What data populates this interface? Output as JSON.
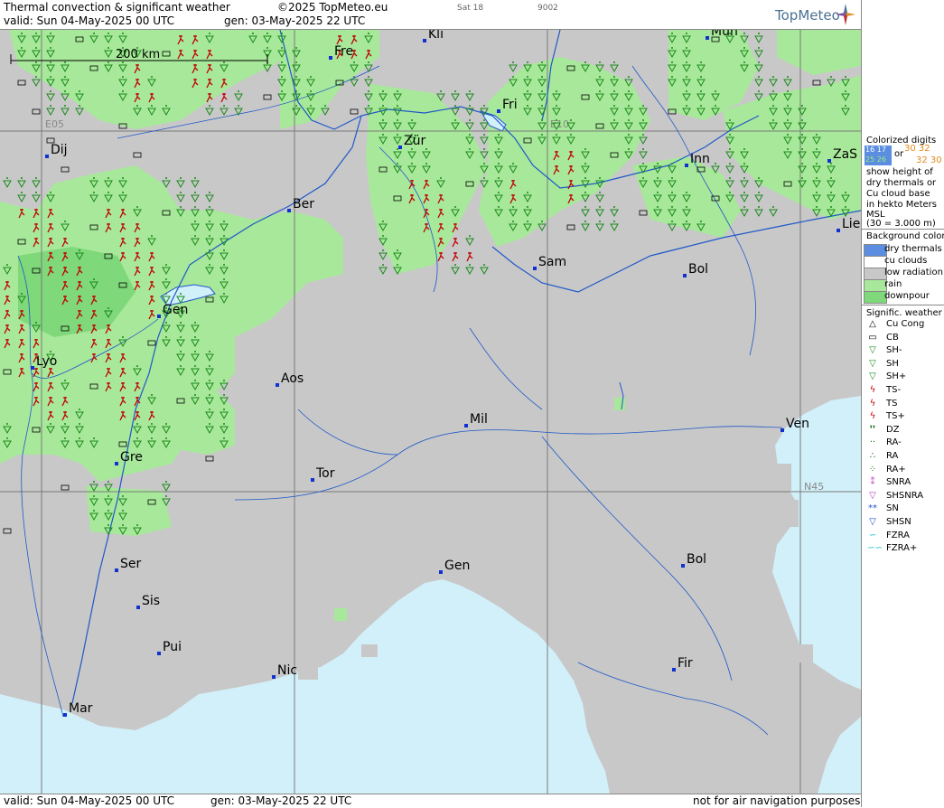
{
  "header": {
    "title": "Thermal convection & significant weather",
    "copyright": "©2025 TopMeteo.eu",
    "valid": "valid:  Sun  04-May-2025  00 UTC",
    "generated": "gen:  03-May-2025  22 UTC",
    "day_tag": "Sat 18",
    "code": "9002",
    "logo": "TopMeteo"
  },
  "footer": {
    "valid": "valid:  Sun  04-May-2025  00 UTC",
    "generated": "gen:  03-May-2025  22 UTC",
    "disclaimer": "not for air navigation purposes"
  },
  "map": {
    "scale_label": "200 km",
    "grid_labels": [
      "E05",
      "E10",
      "N45"
    ],
    "cities": [
      {
        "name": "Kli"
      },
      {
        "name": "Mün"
      },
      {
        "name": "Fre"
      },
      {
        "name": "Fri"
      },
      {
        "name": "Dij"
      },
      {
        "name": "Zür"
      },
      {
        "name": "Inn"
      },
      {
        "name": "ZaS"
      },
      {
        "name": "Ber"
      },
      {
        "name": "Lie"
      },
      {
        "name": "Sam"
      },
      {
        "name": "Bol"
      },
      {
        "name": "Gen"
      },
      {
        "name": "Lyo"
      },
      {
        "name": "Aos"
      },
      {
        "name": "Mil"
      },
      {
        "name": "Ven"
      },
      {
        "name": "Gre"
      },
      {
        "name": "Tor"
      },
      {
        "name": "Gen"
      },
      {
        "name": "Bol"
      },
      {
        "name": "Ser"
      },
      {
        "name": "Sis"
      },
      {
        "name": "Pui"
      },
      {
        "name": "Nic"
      },
      {
        "name": "Fir"
      },
      {
        "name": "Mar"
      }
    ]
  },
  "legend": {
    "colorized_title": [
      "Colorized digits",
      "or",
      "show height of",
      "dry thermals or",
      "Cu cloud base",
      "in hekto Meters",
      "MSL",
      "(30 = 3.000 m)"
    ],
    "digit_samples": [
      "16 17",
      "25 26",
      "30 32",
      "32 30"
    ],
    "bg_title": "Background color",
    "bg_items": [
      {
        "label": "dry thermals",
        "color": "#5b8de0"
      },
      {
        "label": "cu clouds",
        "color": "#ffffff"
      },
      {
        "label": "low radiation",
        "color": "#c8c8c8"
      },
      {
        "label": "rain",
        "color": "#a8e89a"
      },
      {
        "label": "downpour",
        "color": "#7fd87a"
      }
    ],
    "wx_title": "Signific. weather",
    "wx_items": [
      {
        "label": "Cu Cong",
        "icon": "cu-cong"
      },
      {
        "label": "CB",
        "icon": "cb"
      },
      {
        "label": "SH-",
        "icon": "sh-light"
      },
      {
        "label": "SH",
        "icon": "sh"
      },
      {
        "label": "SH+",
        "icon": "sh-heavy"
      },
      {
        "label": "TS-",
        "icon": "ts-light"
      },
      {
        "label": "TS",
        "icon": "ts"
      },
      {
        "label": "TS+",
        "icon": "ts-heavy"
      },
      {
        "label": "DZ",
        "icon": "dz"
      },
      {
        "label": "RA-",
        "icon": "ra-light"
      },
      {
        "label": "RA",
        "icon": "ra"
      },
      {
        "label": "RA+",
        "icon": "ra-heavy"
      },
      {
        "label": "SNRA",
        "icon": "snra"
      },
      {
        "label": "SHSNRA",
        "icon": "shsnra"
      },
      {
        "label": "SN",
        "icon": "sn"
      },
      {
        "label": "SHSN",
        "icon": "shsn"
      },
      {
        "label": "FZRA",
        "icon": "fzra"
      },
      {
        "label": "FZRA+",
        "icon": "fzra-heavy"
      }
    ],
    "colors": {
      "sea": "#d2f0fa",
      "land": "#c8c8c8",
      "shower": "#a8e89a",
      "ts_red": "#c00000",
      "green_sym": "#1a8a1a"
    }
  }
}
